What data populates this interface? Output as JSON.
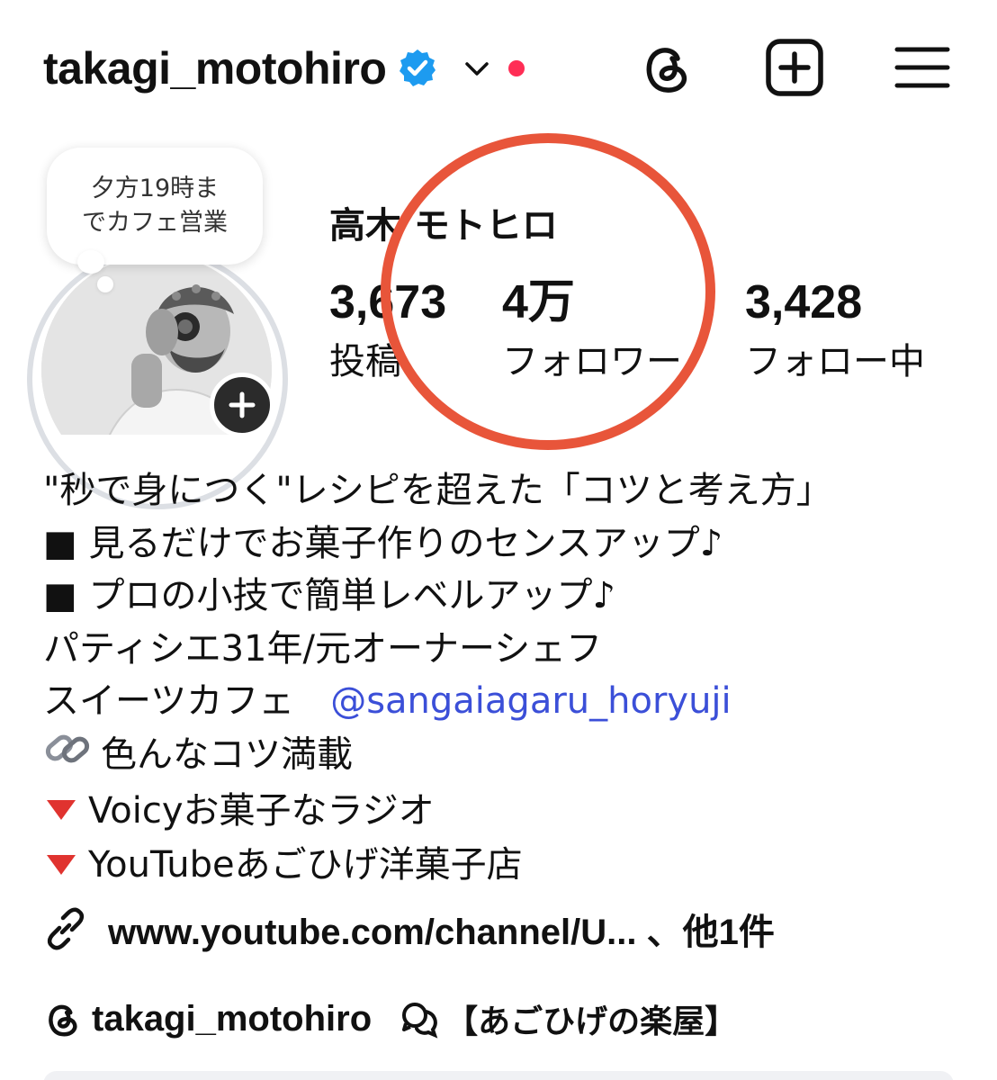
{
  "header": {
    "username": "takagi_motohiro",
    "verified_icon": "verified-badge-icon",
    "chevron_icon": "chevron-down-icon",
    "notification_dot_color": "#ff2d55",
    "threads_icon": "threads-icon",
    "create_icon": "plus-square-icon",
    "menu_icon": "hamburger-menu-icon"
  },
  "profile": {
    "note": "夕方19時ま\nでカフェ営業",
    "display_name": "高木 モトヒロ",
    "stats": [
      {
        "value": "3,673",
        "label": "投稿"
      },
      {
        "value": "4万",
        "label": "フォロワー"
      },
      {
        "value": "3,428",
        "label": "フォロー中"
      }
    ],
    "highlight_color": "#e8553a"
  },
  "bio": {
    "line1": "\"秒で身につく\"レシピを超えた「コツと考え方」",
    "line2": "■ 見るだけでお菓子作りのセンスアップ♪",
    "line3": "■ プロの小技で簡単レベルアップ♪",
    "line4": "パティシエ31年/元オーナーシェフ",
    "line5_prefix": "スイーツカフェ　",
    "line5_mention": "@sangaiagaru_horyuji",
    "line6": "色んなコツ満載",
    "line7": "Voicyお菓子なラジオ",
    "line8": "YouTubeあごひげ洋菓子店",
    "mention_color": "#3b4fd8"
  },
  "links": {
    "text": "www.youtube.com/channel/U... 、他1件",
    "icon": "link-icon"
  },
  "footer": {
    "threads_handle": "takagi_motohiro",
    "group_chat": "【あごひげの楽屋】"
  }
}
